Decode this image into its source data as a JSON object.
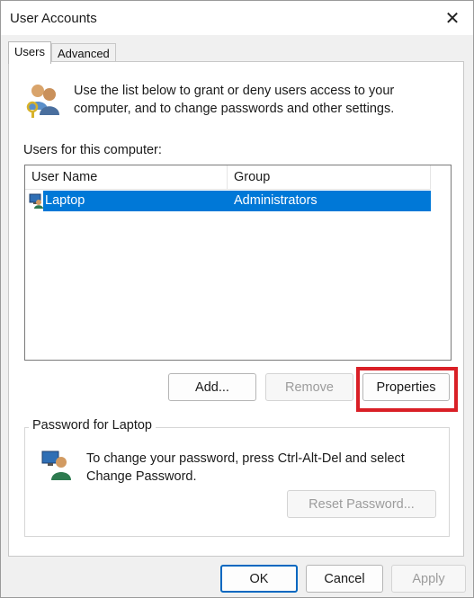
{
  "window": {
    "title": "User Accounts",
    "close_icon": "close-icon"
  },
  "tabs": [
    {
      "label": "Users",
      "active": true
    },
    {
      "label": "Advanced",
      "active": false
    }
  ],
  "intro": {
    "icon": "users-keys-icon",
    "text": "Use the list below to grant or deny users access to your computer, and to change passwords and other settings."
  },
  "users_section": {
    "label": "Users for this computer:",
    "columns": [
      "User Name",
      "Group"
    ],
    "rows": [
      {
        "icon": "user-computer-icon",
        "name": "Laptop",
        "group": "Administrators",
        "selected": true
      }
    ]
  },
  "user_buttons": {
    "add": "Add...",
    "remove": "Remove",
    "properties": "Properties"
  },
  "password_group": {
    "title": "Password for Laptop",
    "icon": "user-password-icon",
    "text": "To change your password, press Ctrl-Alt-Del and select Change Password.",
    "reset_button": "Reset Password..."
  },
  "footer": {
    "ok": "OK",
    "cancel": "Cancel",
    "apply": "Apply"
  },
  "colors": {
    "selection": "#0078d7",
    "highlight_border": "#d91f26"
  }
}
